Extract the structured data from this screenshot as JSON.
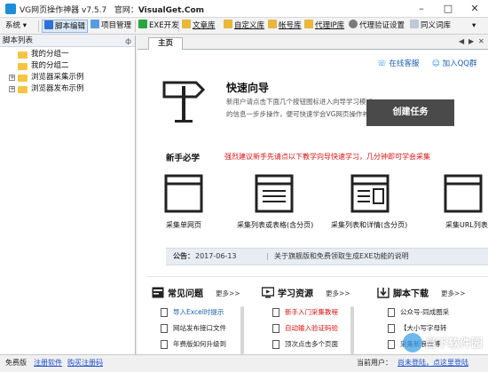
{
  "window": {
    "title": "VG网页操作神器 v7.5.7",
    "site_label": "官网：",
    "site": "VisualGet.Com"
  },
  "toolbar": {
    "items": [
      {
        "label": "系统",
        "icon": "system-menu"
      },
      {
        "label": "脚本编辑",
        "icon": "script-edit-icon"
      },
      {
        "label": "项目管理",
        "icon": "project-icon"
      },
      {
        "label": "EXE开发",
        "icon": "exe-icon"
      },
      {
        "label": "文章库",
        "icon": "folder-icon"
      },
      {
        "label": "自定义库",
        "icon": "folder-icon"
      },
      {
        "label": "帐号库",
        "icon": "folder-icon"
      },
      {
        "label": "代理IP库",
        "icon": "folder-icon"
      },
      {
        "label": "代理验证设置",
        "icon": "gear-icon"
      },
      {
        "label": "同义词库",
        "icon": "book-icon"
      }
    ],
    "colors": {
      "active_border": "#8fb6e0",
      "active_bg": "#dbe9f8"
    }
  },
  "sidebar": {
    "title": "脚本列表",
    "pin": "ф",
    "items": [
      {
        "label": "我的分组一",
        "expandable": false
      },
      {
        "label": "我的分组二",
        "expandable": false
      },
      {
        "label": "浏览器采集示例",
        "expandable": true
      },
      {
        "label": "浏览器发布示例",
        "expandable": true
      }
    ]
  },
  "tabs": {
    "home": "主页",
    "controls": [
      "◀",
      "▶",
      "✕"
    ]
  },
  "main": {
    "links": {
      "online_service": "在线客服",
      "join_qq": "加入QQ群"
    },
    "quick": {
      "title": "快速向导",
      "desc_line1": "新用户请点击下面几个按钮图标进入向导学习模式，",
      "desc_line2": "的信息一步步操作，便可快速学会VG网页操作神器",
      "create_button": "创建任务"
    },
    "newbie": {
      "title": "新手必学",
      "tip": "强烈建议新手先请点以下教学向导快速学习，几分钟即可学会采集"
    },
    "cards": [
      {
        "label": "采集单网页",
        "icon": "single-page-icon"
      },
      {
        "label": "采集列表或表格(含分页)",
        "icon": "list-table-icon"
      },
      {
        "label": "采集列表和详情(含分页)",
        "icon": "list-detail-icon"
      },
      {
        "label": "采集URL列表",
        "icon": "url-list-icon"
      }
    ],
    "notice": {
      "label": "公告：",
      "date": "2017-06-13",
      "sep": "|",
      "text": "关于旗舰版和免费领取生成EXE功能的说明"
    },
    "columns": [
      {
        "title": "常见问题",
        "more": "更多>>",
        "icon": "news-icon",
        "items": [
          {
            "text": "导入Excel时提示",
            "red": false
          },
          {
            "text": "网站发布接口文件",
            "red": false
          },
          {
            "text": "年费版如何升级到",
            "red": false
          }
        ]
      },
      {
        "title": "学习资源",
        "more": "更多>>",
        "icon": "learning-icon",
        "items": [
          {
            "text": "新手入门采集教程",
            "red": true
          },
          {
            "text": "自动输入验证码验",
            "red": true
          },
          {
            "text": "顶次点击多个页面",
            "red": false
          }
        ]
      },
      {
        "title": "脚本下载",
        "more": "更多>>",
        "icon": "download-icon",
        "items": [
          {
            "text": "公众号-同成圈采",
            "red": false
          },
          {
            "text": "【大小写字母转",
            "red": false
          },
          {
            "text": "采集新浪微博",
            "red": false
          }
        ]
      }
    ],
    "watermark": "当下软件园"
  },
  "status": {
    "edition": "免费版",
    "register": "注册软件",
    "buy": "购买注册码",
    "user_label": "当前用户：",
    "user_value": "尚未登陆，点这里登陆"
  }
}
